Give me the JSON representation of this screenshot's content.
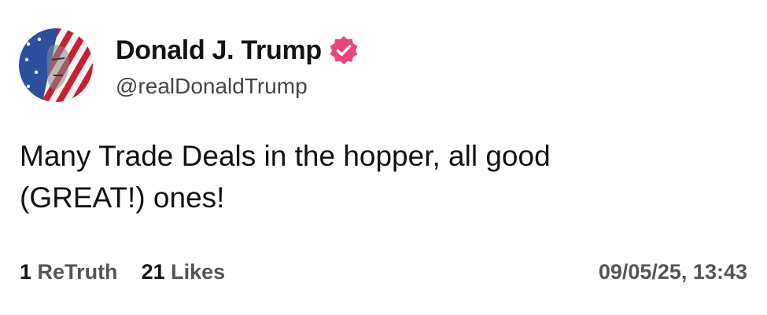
{
  "author": {
    "display_name": "Donald J. Trump",
    "handle": "@realDonaldTrump",
    "verified_icon": "verified-badge-icon",
    "avatar": "profile-avatar",
    "verified_color": "#e8467c"
  },
  "post": {
    "text_line1": "Many Trade Deals in the hopper, all good",
    "text_line2": "(GREAT!) ones!"
  },
  "stats": {
    "retruths_count": "1",
    "retruths_label": "ReTruth",
    "likes_count": "21",
    "likes_label": "Likes"
  },
  "timestamp": "09/05/25, 13:43"
}
